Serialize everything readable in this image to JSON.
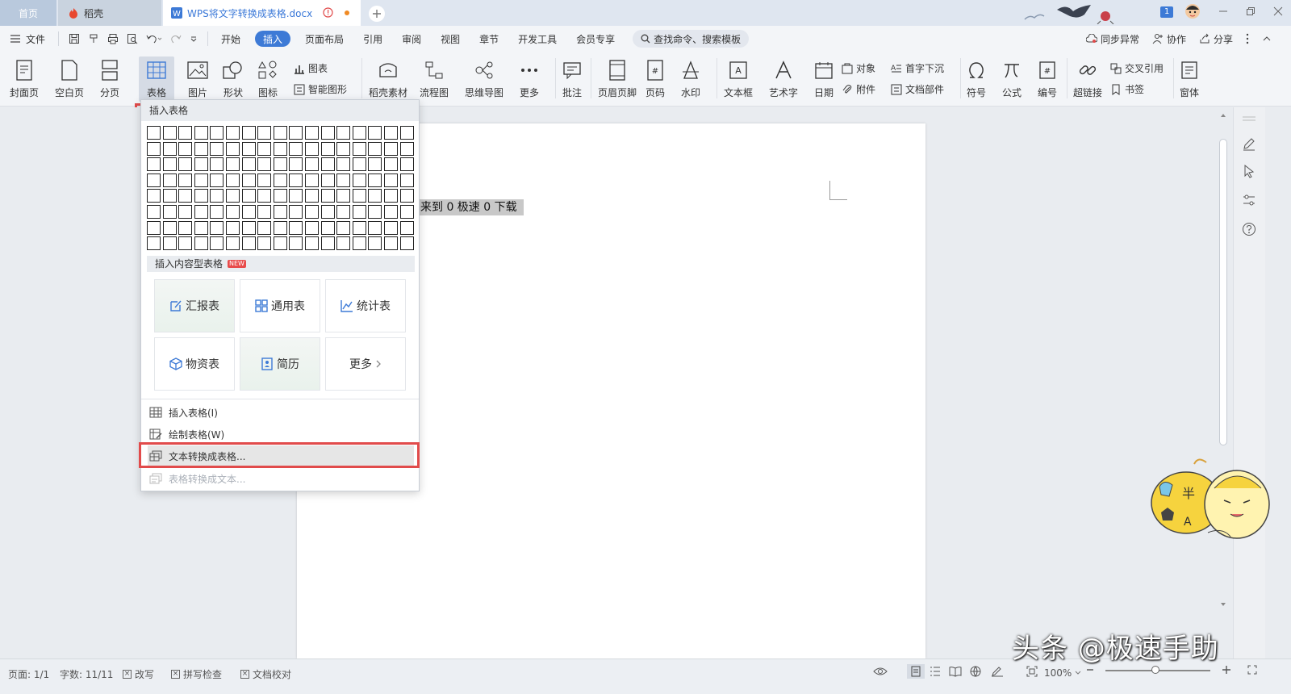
{
  "tabs": {
    "home": "首页",
    "docer": "稻壳",
    "document": "WPS将文字转换成表格.docx"
  },
  "badge": "1",
  "menu": {
    "file": "文件",
    "items": [
      "开始",
      "插入",
      "页面布局",
      "引用",
      "审阅",
      "视图",
      "章节",
      "开发工具",
      "会员专享"
    ],
    "active": "插入",
    "search": "查找命令、搜索模板",
    "sync": "同步异常",
    "collab": "协作",
    "share": "分享"
  },
  "ribbon": {
    "cover": "封面页",
    "blank": "空白页",
    "pagebreak": "分页",
    "table": "表格",
    "picture": "图片",
    "shape": "形状",
    "icon": "图标",
    "chart": "图表",
    "smartart": "智能图形",
    "docer_material": "稻壳素材",
    "flowchart": "流程图",
    "mindmap": "思维导图",
    "more": "更多",
    "comment": "批注",
    "header_footer": "页眉页脚",
    "page_number": "页码",
    "watermark": "水印",
    "textbox": "文本框",
    "wordart": "艺术字",
    "date": "日期",
    "object": "对象",
    "attachment": "附件",
    "dropcap": "首字下沉",
    "docparts": "文档部件",
    "symbol": "符号",
    "formula": "公式",
    "numbering": "编号",
    "hyperlink": "超链接",
    "crossref": "交叉引用",
    "bookmark": "书签",
    "form": "窗体"
  },
  "dropdown": {
    "header": "插入表格",
    "grid": {
      "cols": 17,
      "rows": 8
    },
    "content_header": "插入内容型表格",
    "new_badge": "NEW",
    "cards": [
      "汇报表",
      "通用表",
      "统计表",
      "物资表",
      "简历",
      "更多"
    ],
    "items": [
      {
        "label": "插入表格(I)",
        "enabled": true
      },
      {
        "label": "绘制表格(W)",
        "enabled": true
      },
      {
        "label": "文本转换成表格...",
        "enabled": true,
        "highlighted": true
      },
      {
        "label": "表格转换成文本...",
        "enabled": false
      }
    ]
  },
  "document": {
    "selected_text": "来到 0 极速 0 下载"
  },
  "status": {
    "page": "页面: 1/1",
    "words": "字数: 11/11",
    "revise": "改写",
    "spell": "拼写检查",
    "proof": "文档校对",
    "zoom": "100%",
    "zoom_fraction": 0.48
  },
  "mascot": {
    "text1": "半",
    "text2": "A"
  },
  "watermark": "头条 @极速手助",
  "colors": {
    "accent": "#3d7ad6",
    "highlight_box": "#e14b4b"
  }
}
